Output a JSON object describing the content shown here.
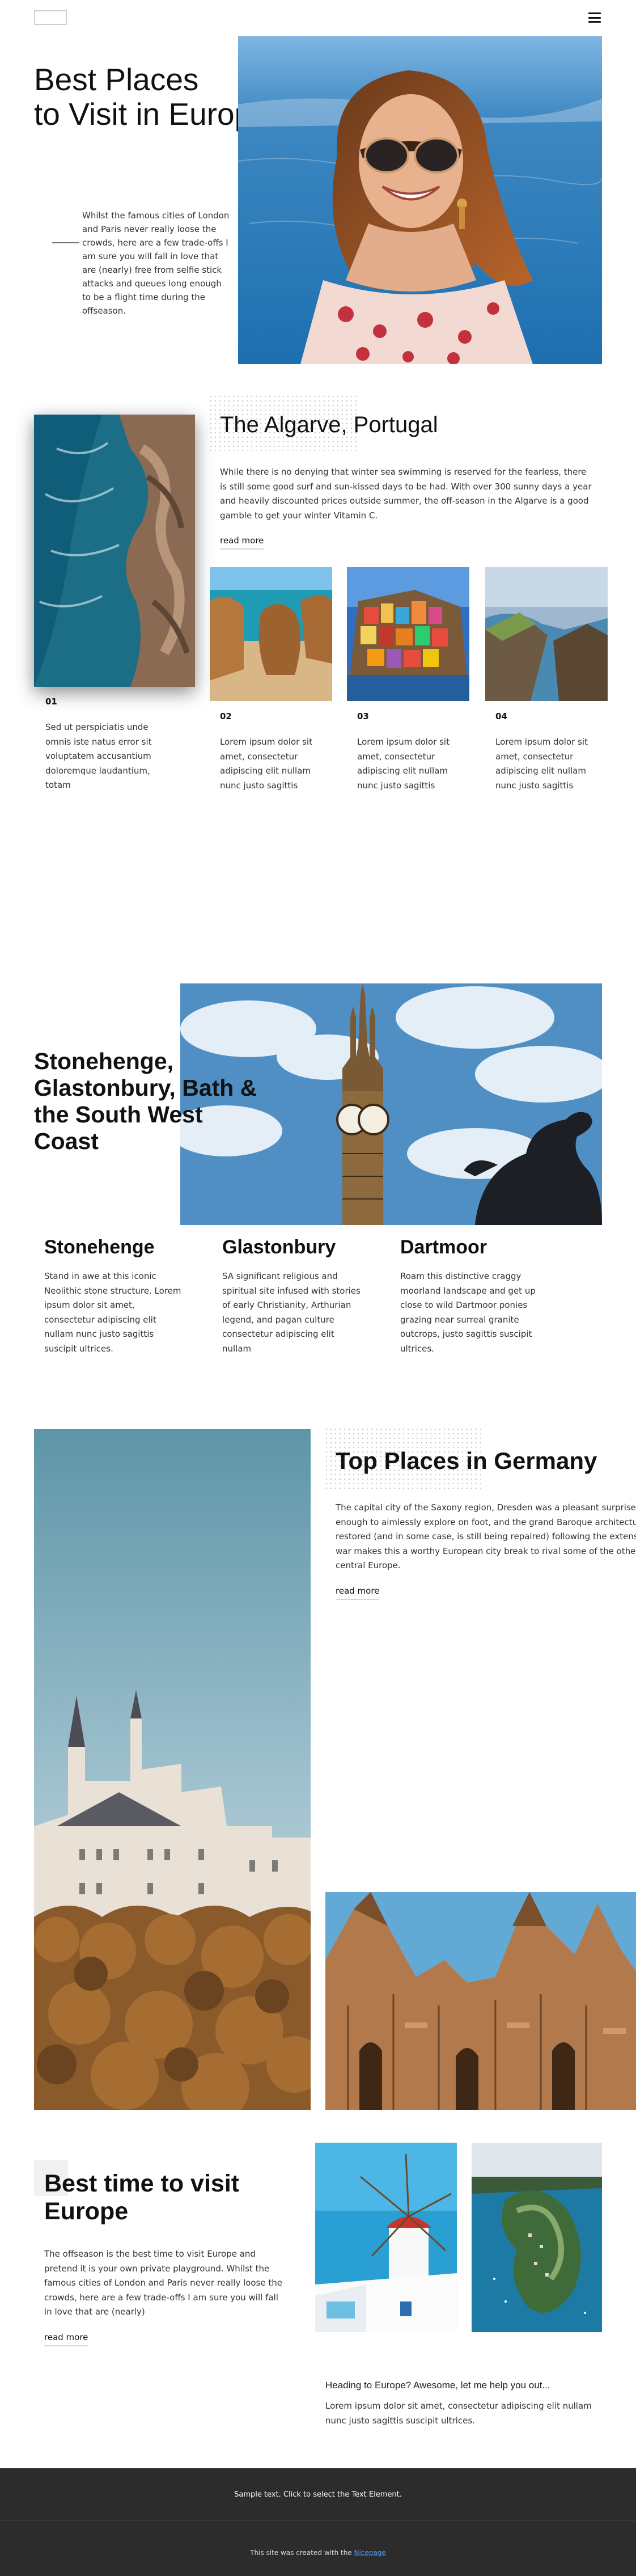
{
  "header": {
    "logo": "logo",
    "menu_icon": "hamburger-menu-icon"
  },
  "hero": {
    "title_line1": "Best Places",
    "title_line2": "to Visit in Europe",
    "text": "Whilst the famous cities of London and Paris never really loose the crowds, here are a few trade-offs I am sure you will fall in love that are (nearly) free from selfie stick attacks and queues long enough to be a flight time during the offseason."
  },
  "algarve": {
    "title": "The Algarve, Portugal",
    "text": "While there is no denying that winter sea swimming is reserved for the fearless, there is still some good surf and sun-kissed days to be had. With over 300 sunny days a year and heavily discounted prices outside summer, the off-season in the Algarve is a good gamble to get your winter Vitamin C.",
    "read_more": "read more",
    "item1": {
      "num": "01",
      "text": "Sed ut perspiciatis unde omnis iste natus error sit voluptatem accusantium doloremque laudantium, totam"
    },
    "item2": {
      "num": "02",
      "text": "Lorem ipsum dolor sit amet, consectetur adipiscing elit nullam nunc justo sagittis"
    },
    "item3": {
      "num": "03",
      "text": "Lorem ipsum dolor sit amet, consectetur adipiscing elit nullam nunc justo sagittis"
    },
    "item4": {
      "num": "04",
      "text": "Lorem ipsum dolor sit amet, consectetur adipiscing elit nullam nunc justo sagittis"
    }
  },
  "southwest": {
    "title_line1": "Stonehenge,",
    "title_line2": "Glastonbury, Bath &",
    "title_line3": "the South West",
    "title_line4": "Coast",
    "cols": [
      {
        "title": "Stonehenge",
        "text": "Stand in awe at this iconic Neolithic stone structure. Lorem ipsum dolor sit amet, consectetur adipiscing elit nullam nunc justo sagittis suscipit ultrices."
      },
      {
        "title": "Glastonbury",
        "text": "SA significant religious and spiritual site infused with stories of early Christianity, Arthurian legend, and pagan culture consectetur adipiscing elit nullam"
      },
      {
        "title": "Dartmoor",
        "text": "Roam this distinctive craggy moorland landscape and get up close to wild Dartmoor ponies grazing near surreal granite outcrops, justo sagittis suscipit ultrices."
      }
    ]
  },
  "germany": {
    "title": "Top Places in Germany",
    "line1": "The capital city of the Saxony region, Dresden was a pleasant surprise. T",
    "line2": "enough to aimlessly explore on foot, and the grand Baroque architecture",
    "line3": "restored (and in some case, is still being repaired) following the extensiv",
    "line4": "war makes this a worthy European city break to rival some of the other g",
    "line5": "central Europe.",
    "read_more": "read more"
  },
  "best_time": {
    "title_line1": "Best time to visit",
    "title_line2": "Europe",
    "text": "The offseason is the best time to visit Europe and pretend it is your own private playground. Whilst the famous cities of London and Paris never really loose the crowds, here are a few trade-offs I am sure you will fall in love that are (nearly)",
    "read_more": "read more",
    "question": "Heading to Europe? Awesome, let me help you out...",
    "question_text": "Lorem ipsum dolor sit amet, consectetur adipiscing elit nullam nunc justo sagittis suscipit ultrices."
  },
  "footer": {
    "sample": "Sample text. Click to select the Text Element.",
    "credit_prefix": "This site was created with the ",
    "credit_link": "Nicepage"
  }
}
